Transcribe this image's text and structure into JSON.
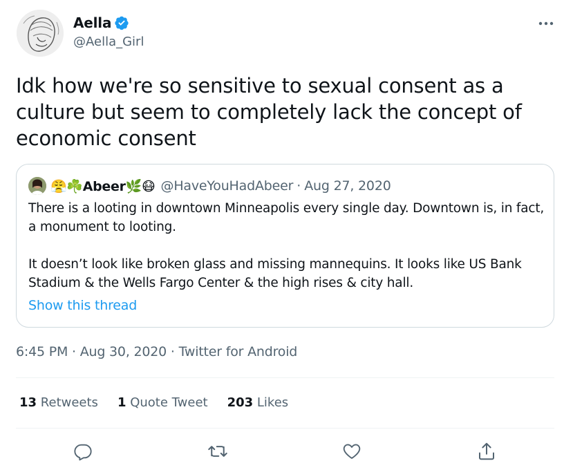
{
  "author": {
    "display_name": "Aella",
    "handle": "@Aella_Girl",
    "avatar_icon": "sketch-portrait-avatar",
    "verified_icon": "verified-badge-icon"
  },
  "tweet": {
    "text": "Idk how we're so sensitive to sexual consent as a culture but seem to completely lack the concept of economic consent"
  },
  "quoted_tweet": {
    "display_name_prefix_emoji": "😤☘️",
    "display_name": "Abeer",
    "display_name_suffix_emoji": "🌿😷",
    "handle": "@HaveYouHadAbeer",
    "separator": "·",
    "date": "Aug 27, 2020",
    "paragraphs": [
      "There is a looting in downtown Minneapolis every single day. Downtown is, in fact, a monument to looting.",
      "It doesn’t look like broken glass and missing mannequins. It looks like US Bank Stadium & the Wells Fargo Center & the high rises & city hall."
    ],
    "show_thread_label": "Show this thread"
  },
  "meta": {
    "time": "6:45 PM",
    "separator": "·",
    "date": "Aug 30, 2020",
    "source": "Twitter for Android"
  },
  "stats": {
    "retweets_count": "13",
    "retweets_label": "Retweets",
    "quotes_count": "1",
    "quotes_label": "Quote Tweet",
    "likes_count": "203",
    "likes_label": "Likes"
  },
  "actions": {
    "reply_icon": "reply-icon",
    "retweet_icon": "retweet-icon",
    "like_icon": "heart-icon",
    "share_icon": "share-icon"
  },
  "colors": {
    "accent": "#1d9bf0",
    "text": "#0f1419",
    "secondary": "#536471",
    "border": "#cfd9de"
  }
}
